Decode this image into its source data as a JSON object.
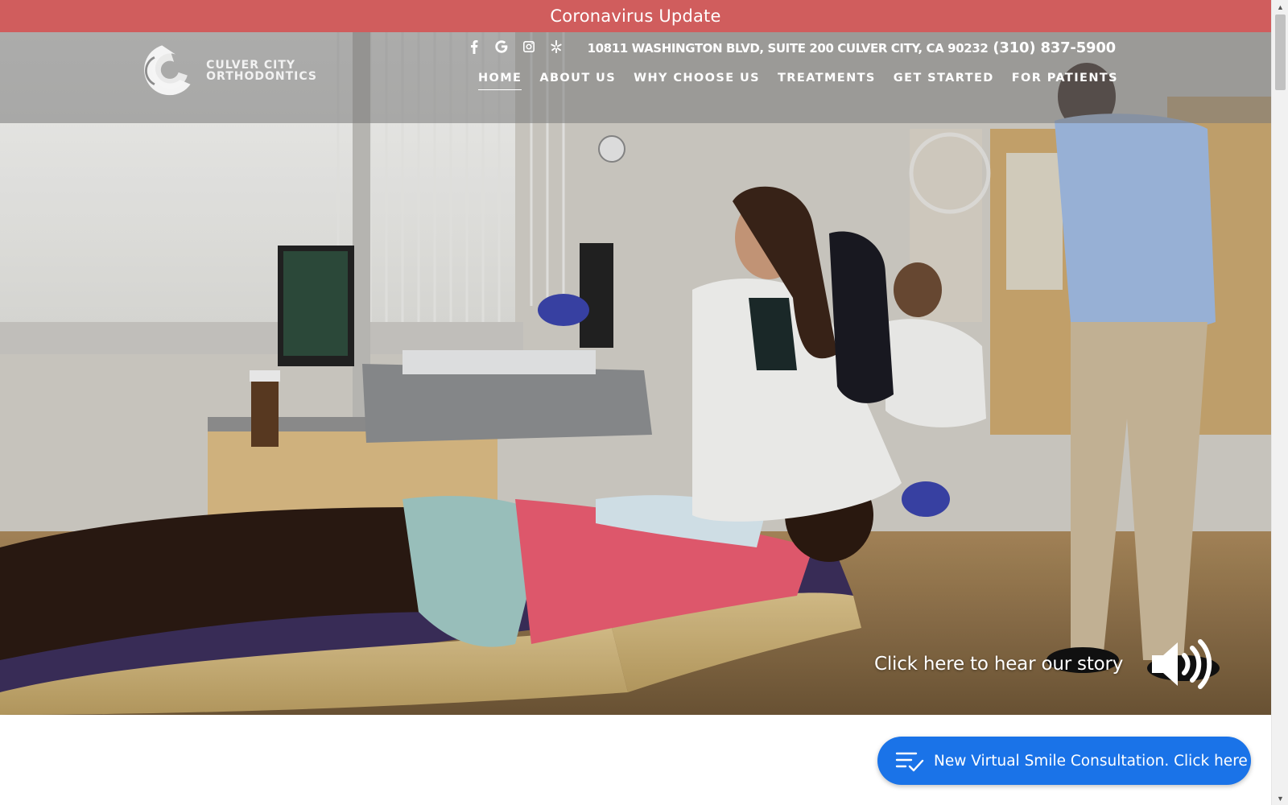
{
  "banner": {
    "label": "Coronavirus Update",
    "color": "#d05d5d"
  },
  "logo": {
    "line1": "CULVER CITY",
    "line2": "ORTHODONTICS"
  },
  "social": [
    {
      "icon": "facebook-icon"
    },
    {
      "icon": "google-icon"
    },
    {
      "icon": "instagram-icon"
    },
    {
      "icon": "yelp-icon"
    }
  ],
  "contact": {
    "address": "10811 WASHINGTON BLVD, SUITE 200 CULVER CITY, CA 90232",
    "phone": "(310) 837-5900"
  },
  "nav": {
    "items": [
      {
        "label": "HOME",
        "active": true
      },
      {
        "label": "ABOUT US"
      },
      {
        "label": "WHY CHOOSE US"
      },
      {
        "label": "TREATMENTS"
      },
      {
        "label": "GET STARTED"
      },
      {
        "label": "FOR PATIENTS"
      }
    ]
  },
  "hero": {
    "story_label": "Click here to hear our story",
    "sound_icon": "speaker-volume-icon"
  },
  "cta": {
    "label": "New Virtual Smile Consultation. Click here",
    "icon": "checklist-icon",
    "color": "#1a73e8"
  }
}
